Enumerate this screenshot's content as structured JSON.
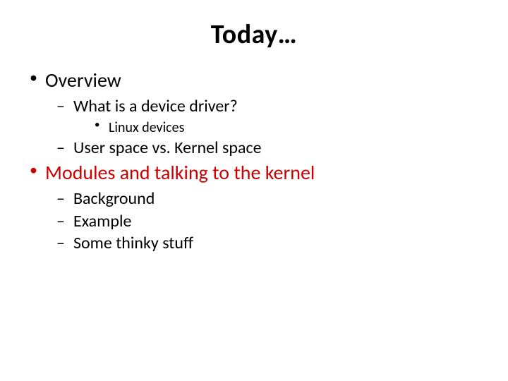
{
  "title": "Today…",
  "items": [
    {
      "text": "Overview",
      "color": "black",
      "subs": [
        {
          "text": "What is a device driver?",
          "subs": [
            {
              "text": "Linux devices"
            }
          ]
        },
        {
          "text": "User space vs. Kernel space"
        }
      ]
    },
    {
      "text": "Modules and talking to the kernel",
      "color": "red",
      "subs": [
        {
          "text": "Background"
        },
        {
          "text": "Example"
        },
        {
          "text": "Some thinky stuff"
        }
      ]
    }
  ]
}
